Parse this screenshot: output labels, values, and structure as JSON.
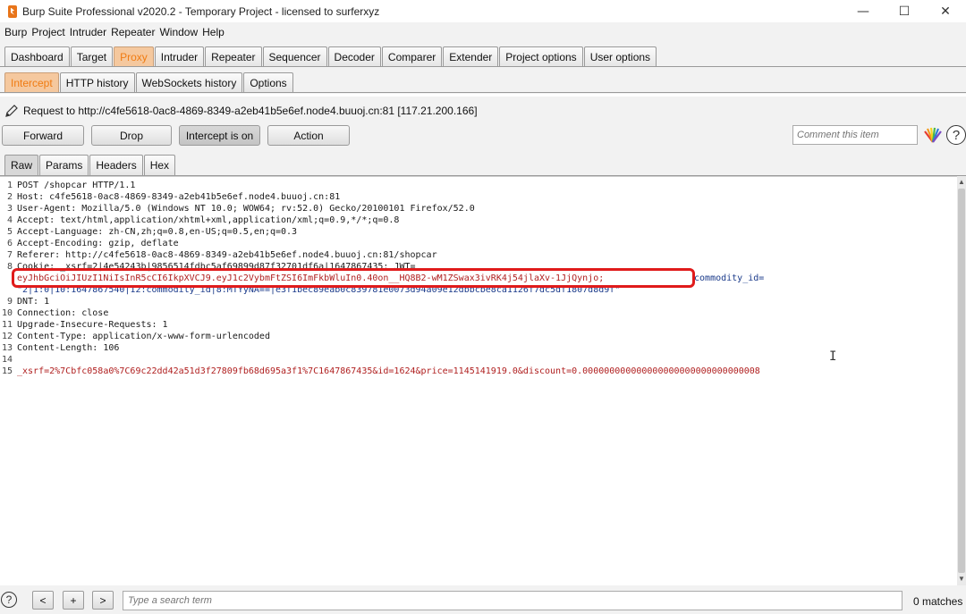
{
  "window": {
    "title": "Burp Suite Professional v2020.2 - Temporary Project - licensed to surferxyz",
    "minimize": "—",
    "maximize": "☐",
    "close": "✕"
  },
  "menu": [
    "Burp",
    "Project",
    "Intruder",
    "Repeater",
    "Window",
    "Help"
  ],
  "main_tabs": [
    {
      "label": "Dashboard",
      "active": false
    },
    {
      "label": "Target",
      "active": false
    },
    {
      "label": "Proxy",
      "active": true
    },
    {
      "label": "Intruder",
      "active": false
    },
    {
      "label": "Repeater",
      "active": false
    },
    {
      "label": "Sequencer",
      "active": false
    },
    {
      "label": "Decoder",
      "active": false
    },
    {
      "label": "Comparer",
      "active": false
    },
    {
      "label": "Extender",
      "active": false
    },
    {
      "label": "Project options",
      "active": false
    },
    {
      "label": "User options",
      "active": false
    }
  ],
  "proxy_tabs": [
    {
      "label": "Intercept",
      "active": true
    },
    {
      "label": "HTTP history",
      "active": false
    },
    {
      "label": "WebSockets history",
      "active": false
    },
    {
      "label": "Options",
      "active": false
    }
  ],
  "request_info": "Request to http://c4fe5618-0ac8-4869-8349-a2eb41b5e6ef.node4.buuoj.cn:81  [117.21.200.166]",
  "actions": {
    "forward": "Forward",
    "drop": "Drop",
    "intercept": "Intercept is on",
    "action": "Action"
  },
  "comment_placeholder": "Comment this item",
  "editor_tabs": [
    {
      "label": "Raw",
      "active": true
    },
    {
      "label": "Params",
      "active": false
    },
    {
      "label": "Headers",
      "active": false
    },
    {
      "label": "Hex",
      "active": false
    }
  ],
  "request_lines": [
    {
      "n": "1",
      "text": "POST /shopcar HTTP/1.1",
      "style": ""
    },
    {
      "n": "2",
      "text": "Host: c4fe5618-0ac8-4869-8349-a2eb41b5e6ef.node4.buuoj.cn:81",
      "style": ""
    },
    {
      "n": "3",
      "text": "User-Agent: Mozilla/5.0 (Windows NT 10.0; WOW64; rv:52.0) Gecko/20100101 Firefox/52.0",
      "style": ""
    },
    {
      "n": "4",
      "text": "Accept: text/html,application/xhtml+xml,application/xml;q=0.9,*/*;q=0.8",
      "style": ""
    },
    {
      "n": "5",
      "text": "Accept-Language: zh-CN,zh;q=0.8,en-US;q=0.5,en;q=0.3",
      "style": ""
    },
    {
      "n": "6",
      "text": "Accept-Encoding: gzip, deflate",
      "style": ""
    },
    {
      "n": "7",
      "text": "Referer: http://c4fe5618-0ac8-4869-8349-a2eb41b5e6ef.node4.buuoj.cn:81/shopcar",
      "style": ""
    },
    {
      "n": "8",
      "text": "Cookie: _xsrf=2|4e54243b|9856514fdbc5af69899d87f32701df6a|1647867435; JWT=",
      "style": ""
    },
    {
      "n": "",
      "text": "eyJhbGciOiJIUzI1NiIsInR5cCI6IkpXVCJ9.eyJ1c2VybmFtZSI6ImFkbWluIn0.40on__HQ8B2-wM1ZSwax3ivRK4j54jlaXv-1JjQynjo;",
      "style": "param",
      "extra": " commodity_id="
    },
    {
      "n": "",
      "text": "\"2|1:0|10:1647867540|12:commodity_id|8:MTYyNA==|e3f1bec89eab0c839781e0073d94a09e12dbbcbe8ca1126f7dc5df1807d8d9f\"",
      "style": "blue"
    },
    {
      "n": "9",
      "text": "DNT: 1",
      "style": ""
    },
    {
      "n": "10",
      "text": "Connection: close",
      "style": ""
    },
    {
      "n": "11",
      "text": "Upgrade-Insecure-Requests: 1",
      "style": ""
    },
    {
      "n": "12",
      "text": "Content-Type: application/x-www-form-urlencoded",
      "style": ""
    },
    {
      "n": "13",
      "text": "Content-Length: 106",
      "style": ""
    },
    {
      "n": "14",
      "text": "",
      "style": ""
    },
    {
      "n": "15",
      "text": "_xsrf=2%7Cbfc058a0%7C69c22dd42a51d3f27809fb68d695a3f1%7C1647867435&id=1624&price=1145141919.0&discount=0.000000000000000000000000000000008",
      "style": "param"
    }
  ],
  "search": {
    "help": "?",
    "prev": "<",
    "add": "+",
    "next": ">",
    "placeholder": "Type a search term",
    "matches": "0 matches"
  },
  "icons": {
    "pencil": "pencil-icon",
    "highlight": "highlight-icon",
    "help": "help-icon"
  },
  "colors": {
    "active_tab": "#f07b12",
    "highlight_box": "#e01b1b",
    "param_text": "#b02020"
  }
}
